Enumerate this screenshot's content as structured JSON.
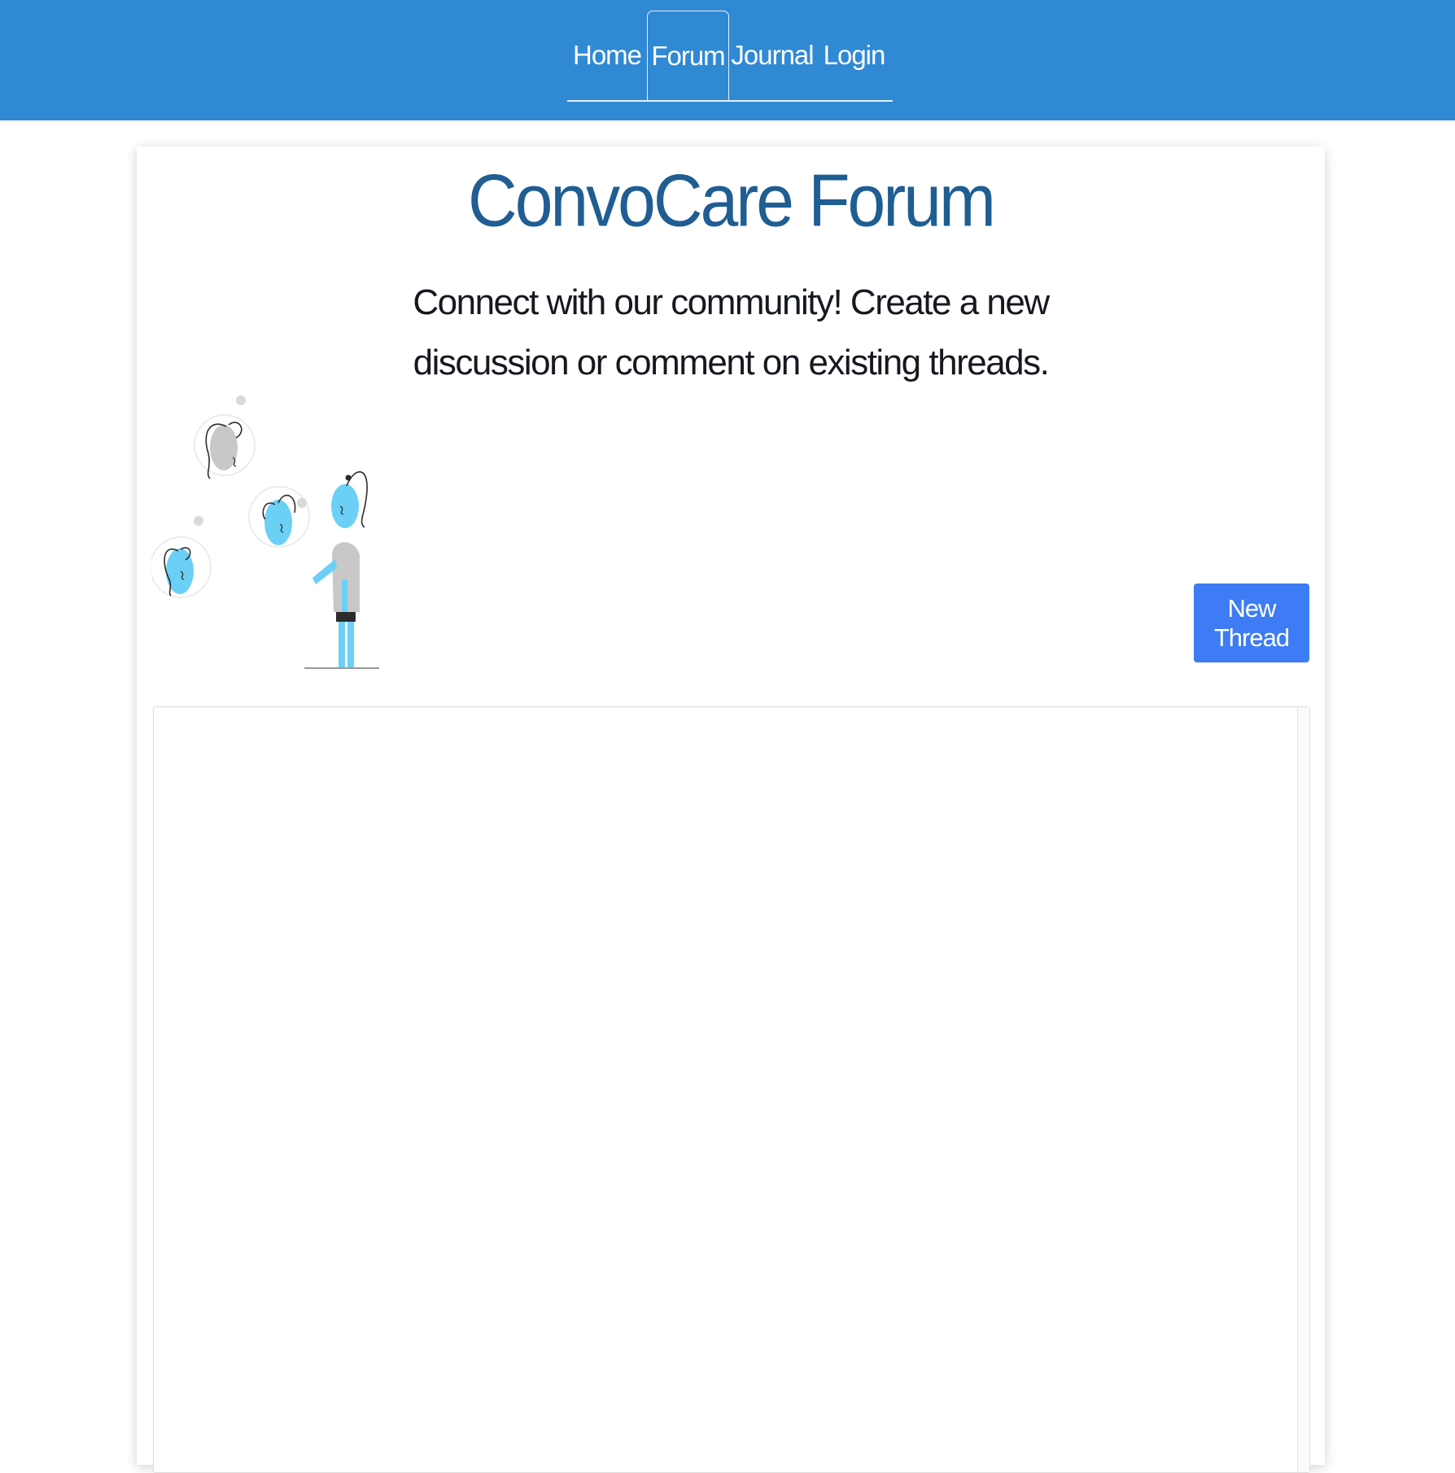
{
  "nav": {
    "tabs": [
      {
        "label": "Home",
        "active": false
      },
      {
        "label": "Forum",
        "active": true
      },
      {
        "label": "Journal",
        "active": false
      },
      {
        "label": "Login",
        "active": false
      }
    ]
  },
  "main": {
    "title": "ConvoCare Forum",
    "subtitle": "Connect with our community! Create a new discussion or comment on existing threads.",
    "new_thread_label": "New Thread"
  },
  "illustration": {
    "name": "community-people-icon"
  },
  "colors": {
    "navbar": "#3089d3",
    "title": "#1f5d93",
    "button": "#3d7cf4",
    "accent_figure": "#6ccff6",
    "gray_figure": "#c8c8c8"
  }
}
